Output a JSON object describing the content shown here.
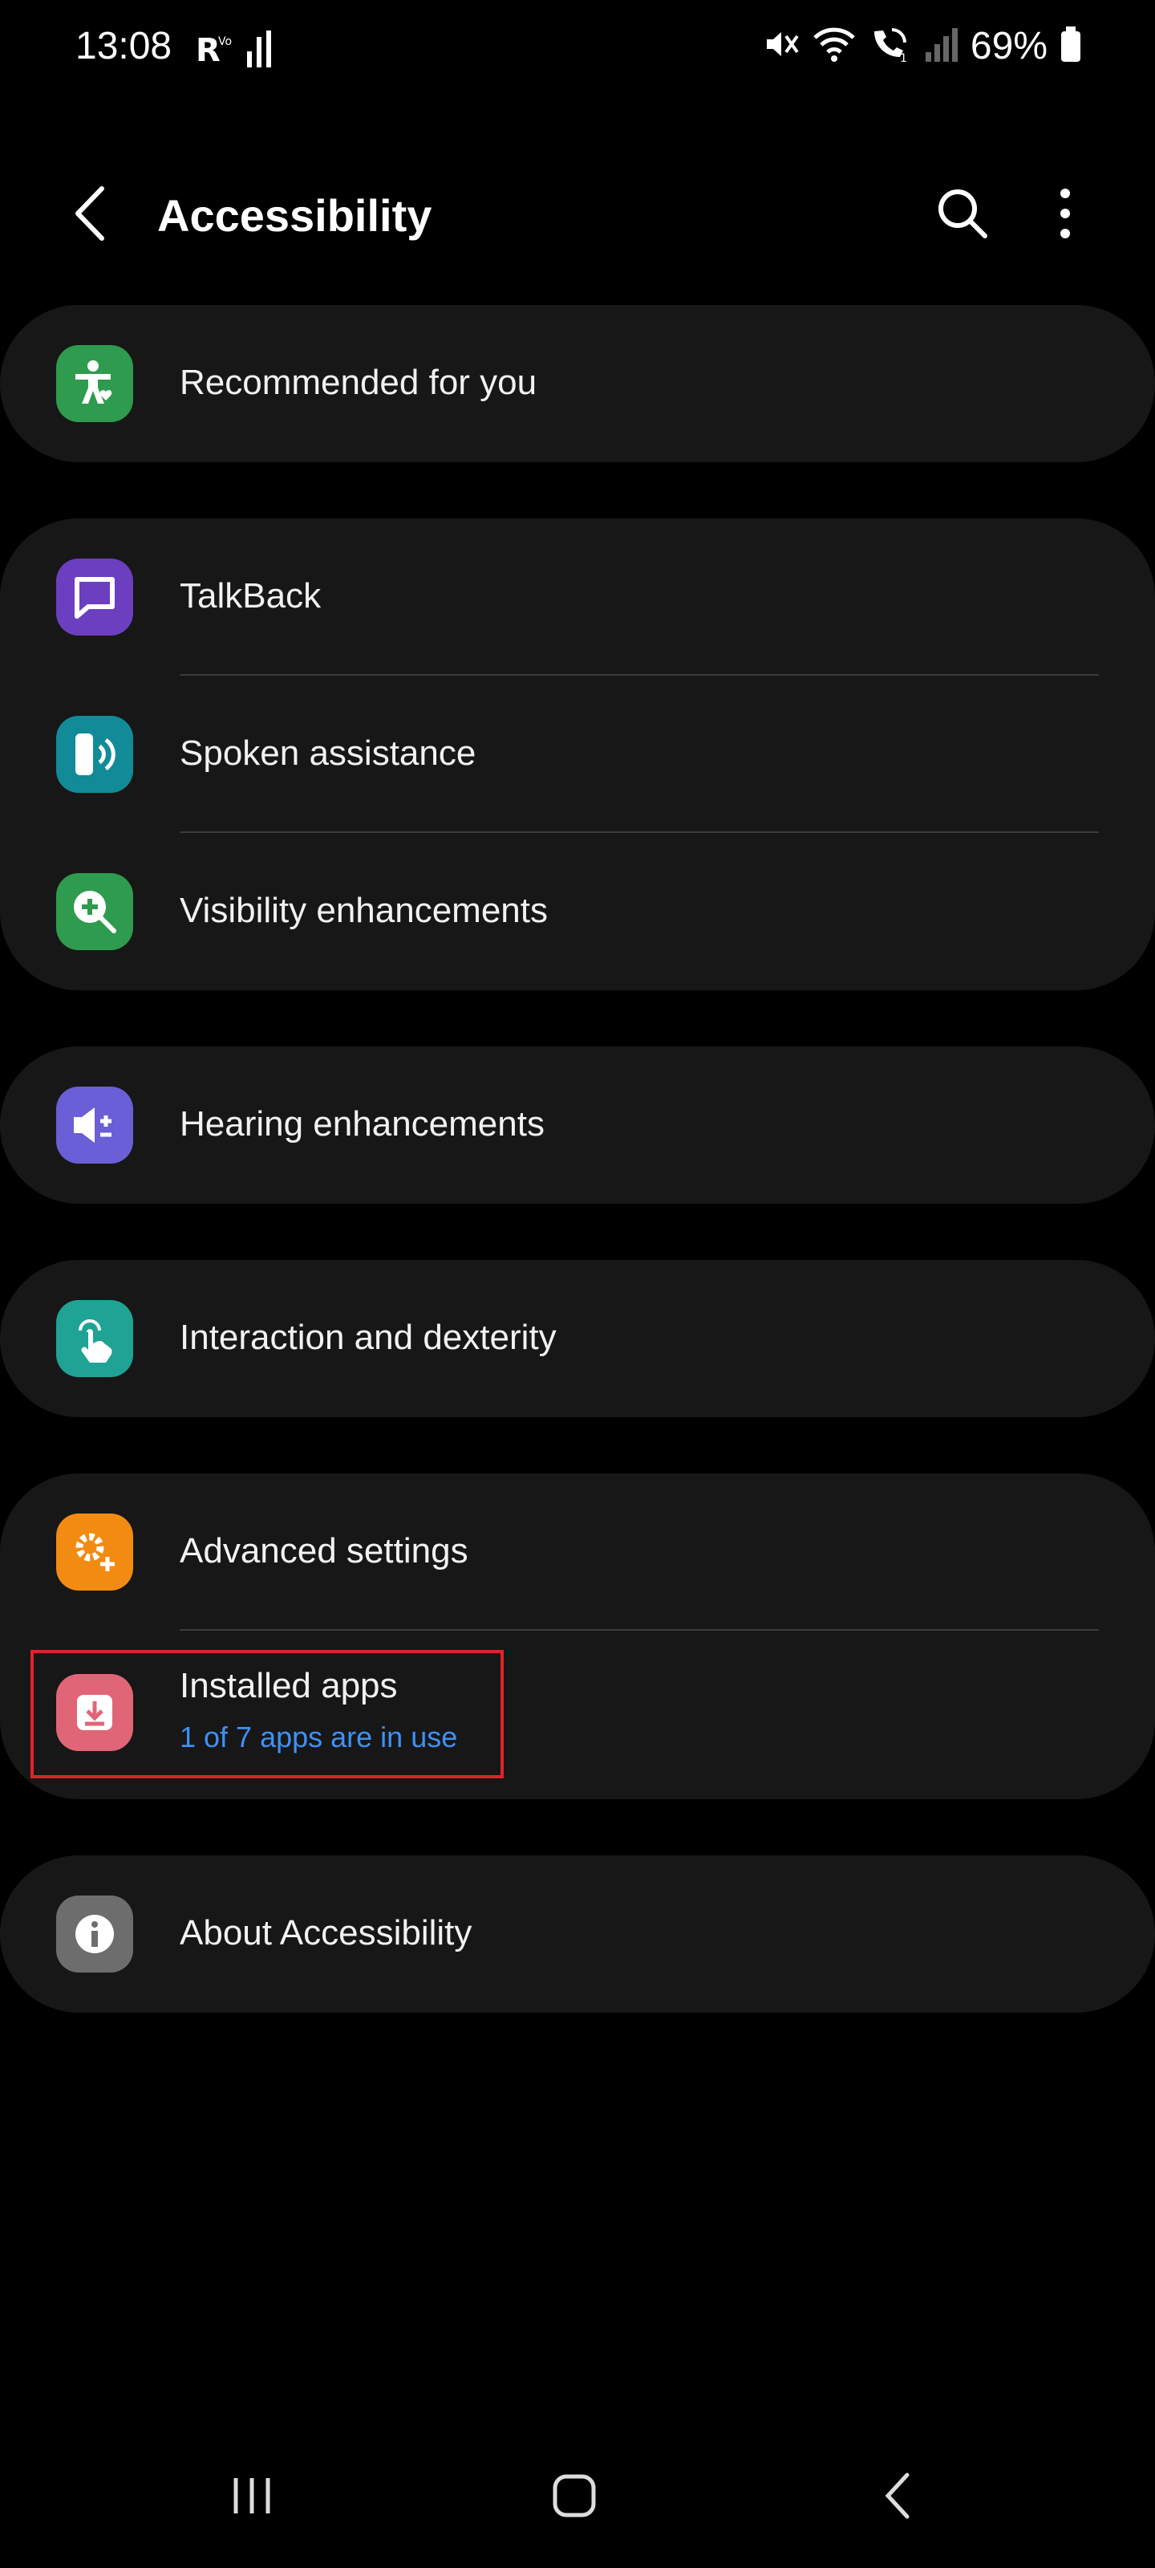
{
  "status_bar": {
    "time": "13:08",
    "battery_percent": "69%",
    "icons": [
      "r-signal-icon",
      "data-activity-icon",
      "mute-icon",
      "wifi-icon",
      "wifi-calling-icon",
      "cell-signal-icon",
      "battery-icon"
    ]
  },
  "app_bar": {
    "title": "Accessibility",
    "icons": [
      "back-icon",
      "search-icon",
      "more-options-icon"
    ]
  },
  "sections": [
    {
      "items": [
        {
          "label": "Recommended for you",
          "icon": "accessibility-person-icon",
          "icon_color": "#2e9b4e"
        }
      ]
    },
    {
      "items": [
        {
          "label": "TalkBack",
          "icon": "talkback-icon",
          "icon_color": "#6b3fc0"
        },
        {
          "label": "Spoken assistance",
          "icon": "spoken-assistance-icon",
          "icon_color": "#128b98"
        },
        {
          "label": "Visibility enhancements",
          "icon": "visibility-zoom-icon",
          "icon_color": "#2e9b4e"
        }
      ]
    },
    {
      "items": [
        {
          "label": "Hearing enhancements",
          "icon": "hearing-icon",
          "icon_color": "#6a5fd6"
        }
      ]
    },
    {
      "items": [
        {
          "label": "Interaction and dexterity",
          "icon": "touch-hand-icon",
          "icon_color": "#1fa394"
        }
      ]
    },
    {
      "items": [
        {
          "label": "Advanced settings",
          "icon": "advanced-gear-icon",
          "icon_color": "#f28b12"
        },
        {
          "label": "Installed apps",
          "sublabel": "1 of 7 apps are in use",
          "icon": "installed-apps-icon",
          "icon_color": "#e06677"
        }
      ]
    },
    {
      "items": [
        {
          "label": "About Accessibility",
          "icon": "info-icon",
          "icon_color": "#6d6d6d"
        }
      ]
    }
  ],
  "nav_bar": {
    "icons": [
      "recent-apps-icon",
      "home-icon",
      "back-nav-icon"
    ]
  },
  "colors": {
    "background": "#000000",
    "card": "#171717",
    "sublabel_accent": "#3e91f4",
    "highlight_border": "#e0232b"
  }
}
